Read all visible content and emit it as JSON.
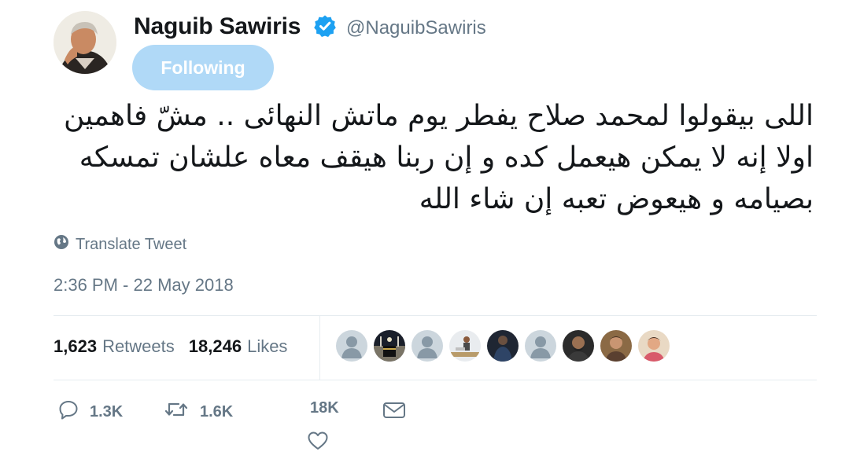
{
  "author": {
    "name": "Naguib Sawiris",
    "handle": "@NaguibSawiris",
    "follow_label": "Following"
  },
  "tweet": {
    "text": "اللى بيقولوا لمحمد صلاح يفطر يوم ماتش النهائى .. مشّ فاهمين اولا إنه لا يمكن هيعمل كده و إن ربنا هيقف معاه علشان تمسكه بصيامه و هيعوض تعبه إن شاء الله",
    "translate_label": "Translate Tweet",
    "timestamp": "2:36 PM - 22 May 2018"
  },
  "stats": {
    "retweets_count": "1,623",
    "retweets_label": "Retweets",
    "likes_count": "18,246",
    "likes_label": "Likes"
  },
  "likers": [
    {
      "icon": "default-avatar"
    },
    {
      "icon": "kaaba-photo-avatar"
    },
    {
      "icon": "default-avatar"
    },
    {
      "icon": "person-photo-avatar"
    },
    {
      "icon": "person-photo-avatar"
    },
    {
      "icon": "default-avatar"
    },
    {
      "icon": "person-photo-avatar"
    },
    {
      "icon": "person-photo-avatar"
    },
    {
      "icon": "person-photo-avatar"
    }
  ],
  "actions": {
    "reply_count": "1.3K",
    "retweet_count": "1.6K",
    "like_count": "18K"
  },
  "colors": {
    "accent": "#1da1f2",
    "follow_button_bg": "#b0d9f7",
    "secondary_text": "#657786",
    "divider": "#e6ecf0"
  }
}
